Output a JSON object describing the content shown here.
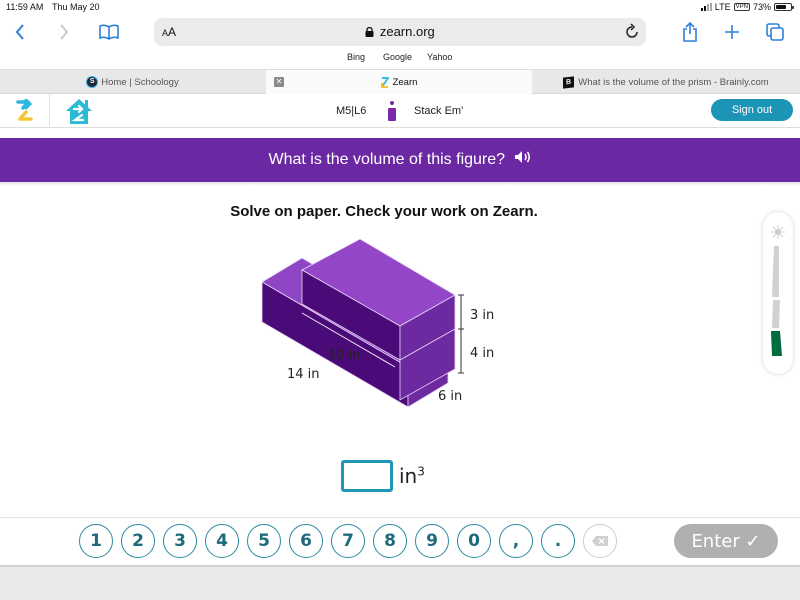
{
  "status_bar": {
    "time": "11:59 AM",
    "date": "Thu May 20",
    "network": "LTE",
    "vpn": "VPN",
    "battery": "73%",
    "battery_level": 0.73
  },
  "browser": {
    "text_size_label": "AA",
    "url": "zearn.org",
    "bookmarks": [
      "Bing",
      "Google",
      "Yahoo"
    ],
    "tabs": [
      {
        "label": "Home | Schoology",
        "favicon": "S",
        "active": false
      },
      {
        "label": "Zearn",
        "favicon": "zearn-logo",
        "active": true
      },
      {
        "label": "What is the volume of the prism - Brainly.com",
        "favicon": "B",
        "active": false
      }
    ],
    "close_tab_glyph": "✕"
  },
  "app_header": {
    "lesson_code": "M5|L6",
    "lesson_name": "Stack Em'",
    "sign_out_label": "Sign out"
  },
  "question": {
    "prompt": "What is the volume of this figure?",
    "instructions": "Solve on paper. Check your work on Zearn.",
    "figure_labels": {
      "top_height": "3 in",
      "bottom_height": "4 in",
      "width": "6 in",
      "top_length": "10 in",
      "bottom_length": "14 in"
    },
    "answer_value": "",
    "unit": "in",
    "unit_exponent": "3"
  },
  "scale_widget": {
    "segments_total": 3,
    "segments_filled": 1,
    "filled_color": "#006b3f"
  },
  "keypad": {
    "keys": [
      "1",
      "2",
      "3",
      "4",
      "5",
      "6",
      "7",
      "8",
      "9",
      "0",
      ",",
      "."
    ],
    "backspace_glyph": "⌫",
    "enter_label": "Enter ✓"
  },
  "colors": {
    "banner_purple": "#6c28a2",
    "accent_teal": "#1c94b5",
    "enter_disabled": "#b0b0b0"
  }
}
